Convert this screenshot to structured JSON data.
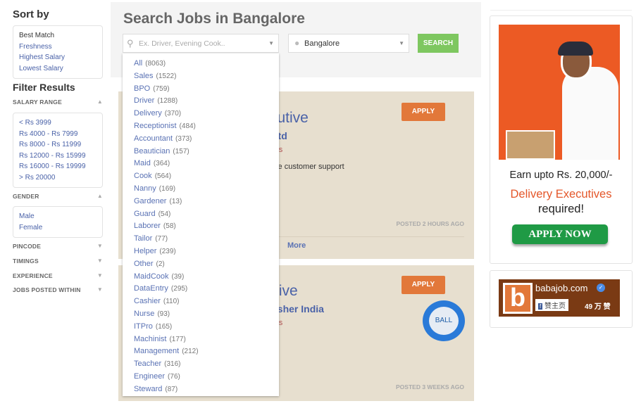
{
  "sort": {
    "title": "Sort by",
    "options": [
      "Best Match",
      "Freshness",
      "Highest Salary",
      "Lowest Salary"
    ]
  },
  "filter": {
    "title": "Filter Results",
    "salary": {
      "label": "SALARY RANGE",
      "options": [
        "< Rs 3999",
        "Rs 4000 - Rs 7999",
        "Rs 8000 - Rs 11999",
        "Rs 12000 - Rs 15999",
        "Rs 16000 - Rs 19999",
        "> Rs 20000"
      ]
    },
    "gender": {
      "label": "GENDER",
      "options": [
        "Male",
        "Female"
      ]
    },
    "collapsed": [
      "PINCODE",
      "TIMINGS",
      "EXPERIENCE",
      "JOBS POSTED WITHIN"
    ]
  },
  "search": {
    "title": "Search Jobs in Bangalore",
    "placeholder": "Ex. Driver, Evening Cook..",
    "location": "Bangalore",
    "button": "SEARCH"
  },
  "categories": [
    {
      "name": "All",
      "count": "(8063)"
    },
    {
      "name": "Sales",
      "count": "(1522)"
    },
    {
      "name": "BPO",
      "count": "(759)"
    },
    {
      "name": "Driver",
      "count": "(1288)"
    },
    {
      "name": "Delivery",
      "count": "(370)"
    },
    {
      "name": "Receptionist",
      "count": "(484)"
    },
    {
      "name": "Accountant",
      "count": "(373)"
    },
    {
      "name": "Beautician",
      "count": "(157)"
    },
    {
      "name": "Maid",
      "count": "(364)"
    },
    {
      "name": "Cook",
      "count": "(564)"
    },
    {
      "name": "Nanny",
      "count": "(169)"
    },
    {
      "name": "Gardener",
      "count": "(13)"
    },
    {
      "name": "Guard",
      "count": "(54)"
    },
    {
      "name": "Laborer",
      "count": "(58)"
    },
    {
      "name": "Tailor",
      "count": "(77)"
    },
    {
      "name": "Helper",
      "count": "(239)"
    },
    {
      "name": "Other",
      "count": "(2)"
    },
    {
      "name": "MaidCook",
      "count": "(39)"
    },
    {
      "name": "DataEntry",
      "count": "(295)"
    },
    {
      "name": "Cashier",
      "count": "(110)"
    },
    {
      "name": "Nurse",
      "count": "(93)"
    },
    {
      "name": "ITPro",
      "count": "(165)"
    },
    {
      "name": "Machinist",
      "count": "(177)"
    },
    {
      "name": "Management",
      "count": "(212)"
    },
    {
      "name": "Teacher",
      "count": "(316)"
    },
    {
      "name": "Engineer",
      "count": "(76)"
    },
    {
      "name": "Steward",
      "count": "(87)"
    }
  ],
  "jobs": [
    {
      "title": "cutive",
      "company": "Ltd",
      "experience": "ars",
      "desc1": "ale customer support",
      "desc2": "e",
      "apply": "APPLY",
      "posted": "POSTED 2 HOURS AGO",
      "more": "More"
    },
    {
      "title": "tive",
      "company": "asher India",
      "experience": "ars",
      "apply": "APPLY",
      "posted": "POSTED 3 WEEKS AGO",
      "logo": "BALL"
    }
  ],
  "ad": {
    "line1": "Earn upto Rs. 20,000/-",
    "line2": "Delivery Executives",
    "line3": "required!",
    "button": "APPLY NOW"
  },
  "fb": {
    "name": "babajob.com",
    "like": "赞主页",
    "count": "49 万 赞",
    "logo": "b"
  },
  "colors": {
    "link": "#4a62a8",
    "search": "#7ec760",
    "apply": "#e2783a",
    "card": "#e7dfcf",
    "ad_bg": "#ec5a24"
  }
}
